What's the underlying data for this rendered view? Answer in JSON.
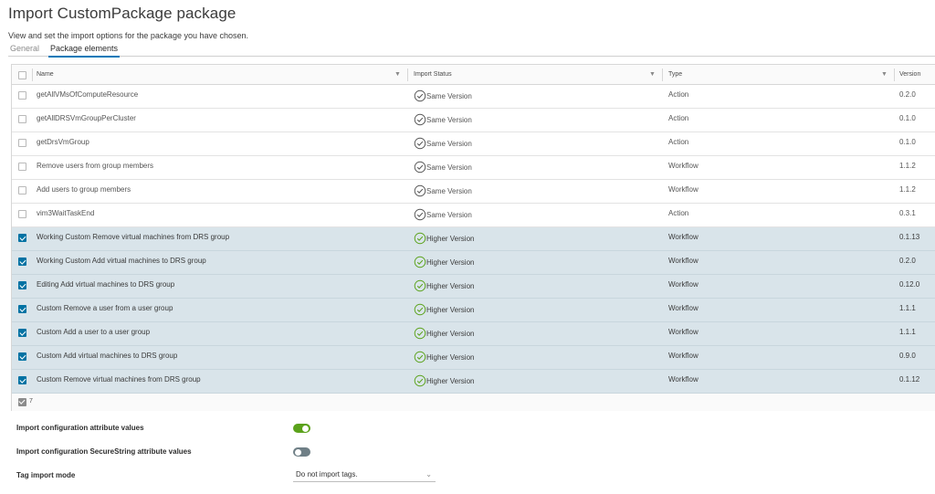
{
  "title": "Import CustomPackage package",
  "subtitle": "View and set the import options for the package you have chosen.",
  "tabs": [
    {
      "label": "General",
      "active": false
    },
    {
      "label": "Package elements",
      "active": true
    }
  ],
  "grid": {
    "columns": {
      "name": "Name",
      "import_status": "Import Status",
      "type": "Type",
      "version": "Version"
    },
    "filter_glyph": "▼",
    "rows": [
      {
        "name": "getAllVMsOfComputeResource",
        "status": "Same Version",
        "type": "Action",
        "version": "0.2.0",
        "selected": false
      },
      {
        "name": "getAllDRSVmGroupPerCluster",
        "status": "Same Version",
        "type": "Action",
        "version": "0.1.0",
        "selected": false
      },
      {
        "name": "getDrsVmGroup",
        "status": "Same Version",
        "type": "Action",
        "version": "0.1.0",
        "selected": false
      },
      {
        "name": "Remove users from group members",
        "status": "Same Version",
        "type": "Workflow",
        "version": "1.1.2",
        "selected": false
      },
      {
        "name": "Add users to group members",
        "status": "Same Version",
        "type": "Workflow",
        "version": "1.1.2",
        "selected": false
      },
      {
        "name": "vim3WaitTaskEnd",
        "status": "Same Version",
        "type": "Action",
        "version": "0.3.1",
        "selected": false
      },
      {
        "name": "Working Custom Remove virtual machines from DRS group",
        "status": "Higher Version",
        "type": "Workflow",
        "version": "0.1.13",
        "selected": true
      },
      {
        "name": "Working Custom Add virtual machines to DRS group",
        "status": "Higher Version",
        "type": "Workflow",
        "version": "0.2.0",
        "selected": true
      },
      {
        "name": "Editing Add virtual machines to DRS group",
        "status": "Higher Version",
        "type": "Workflow",
        "version": "0.12.0",
        "selected": true
      },
      {
        "name": "Custom Remove a user from a user group",
        "status": "Higher Version",
        "type": "Workflow",
        "version": "1.1.1",
        "selected": true
      },
      {
        "name": "Custom Add a user to a user group",
        "status": "Higher Version",
        "type": "Workflow",
        "version": "1.1.1",
        "selected": true
      },
      {
        "name": "Custom Add virtual machines to DRS group",
        "status": "Higher Version",
        "type": "Workflow",
        "version": "0.9.0",
        "selected": true
      },
      {
        "name": "Custom Remove virtual machines from DRS group",
        "status": "Higher Version",
        "type": "Workflow",
        "version": "0.1.12",
        "selected": true
      }
    ],
    "footer_selected_count": "7"
  },
  "options": {
    "import_config_attr": {
      "label": "Import configuration attribute values",
      "on": true
    },
    "import_securestring": {
      "label": "Import configuration SecureString attribute values",
      "on": false
    },
    "tag_mode": {
      "label": "Tag import mode",
      "value": "Do not import tags."
    }
  },
  "colors": {
    "accent": "#0072a3",
    "selected_row": "#d9e4ea",
    "same_version_icon": "#555555",
    "higher_version_icon": "#5ba21b",
    "toggle_on": "#5ba21b",
    "toggle_off": "#6f7f86"
  },
  "icons": {
    "same_version": "check-circle-icon",
    "higher_version": "check-circle-icon",
    "filter": "filter-icon",
    "dropdown": "chevron-down-icon"
  }
}
